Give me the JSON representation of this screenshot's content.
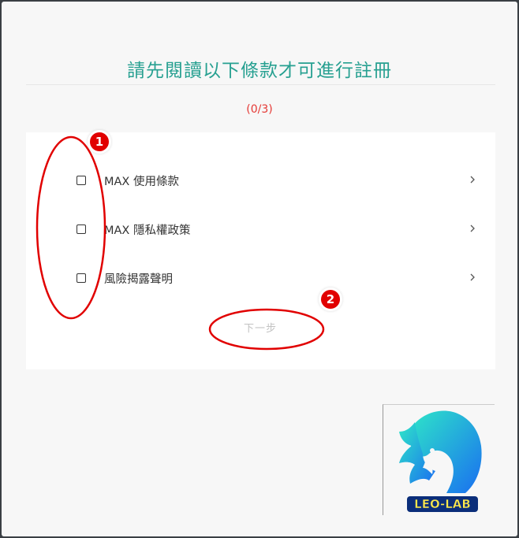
{
  "header": {
    "title": "請先閱讀以下條款才可進行註冊"
  },
  "progress": "(0/3)",
  "terms": [
    {
      "label": "MAX 使用條款",
      "checked": false
    },
    {
      "label": "MAX 隱私權政策",
      "checked": false
    },
    {
      "label": "風險揭露聲明",
      "checked": false
    }
  ],
  "next_button": {
    "label": "下一步"
  },
  "annotations": {
    "badge_1": "1",
    "badge_2": "2"
  },
  "logo": {
    "text": "LEO-LAB"
  },
  "colors": {
    "title": "#27a091",
    "progress": "#e53935",
    "annotation": "#e10000",
    "disabled": "#c2c2c2"
  }
}
